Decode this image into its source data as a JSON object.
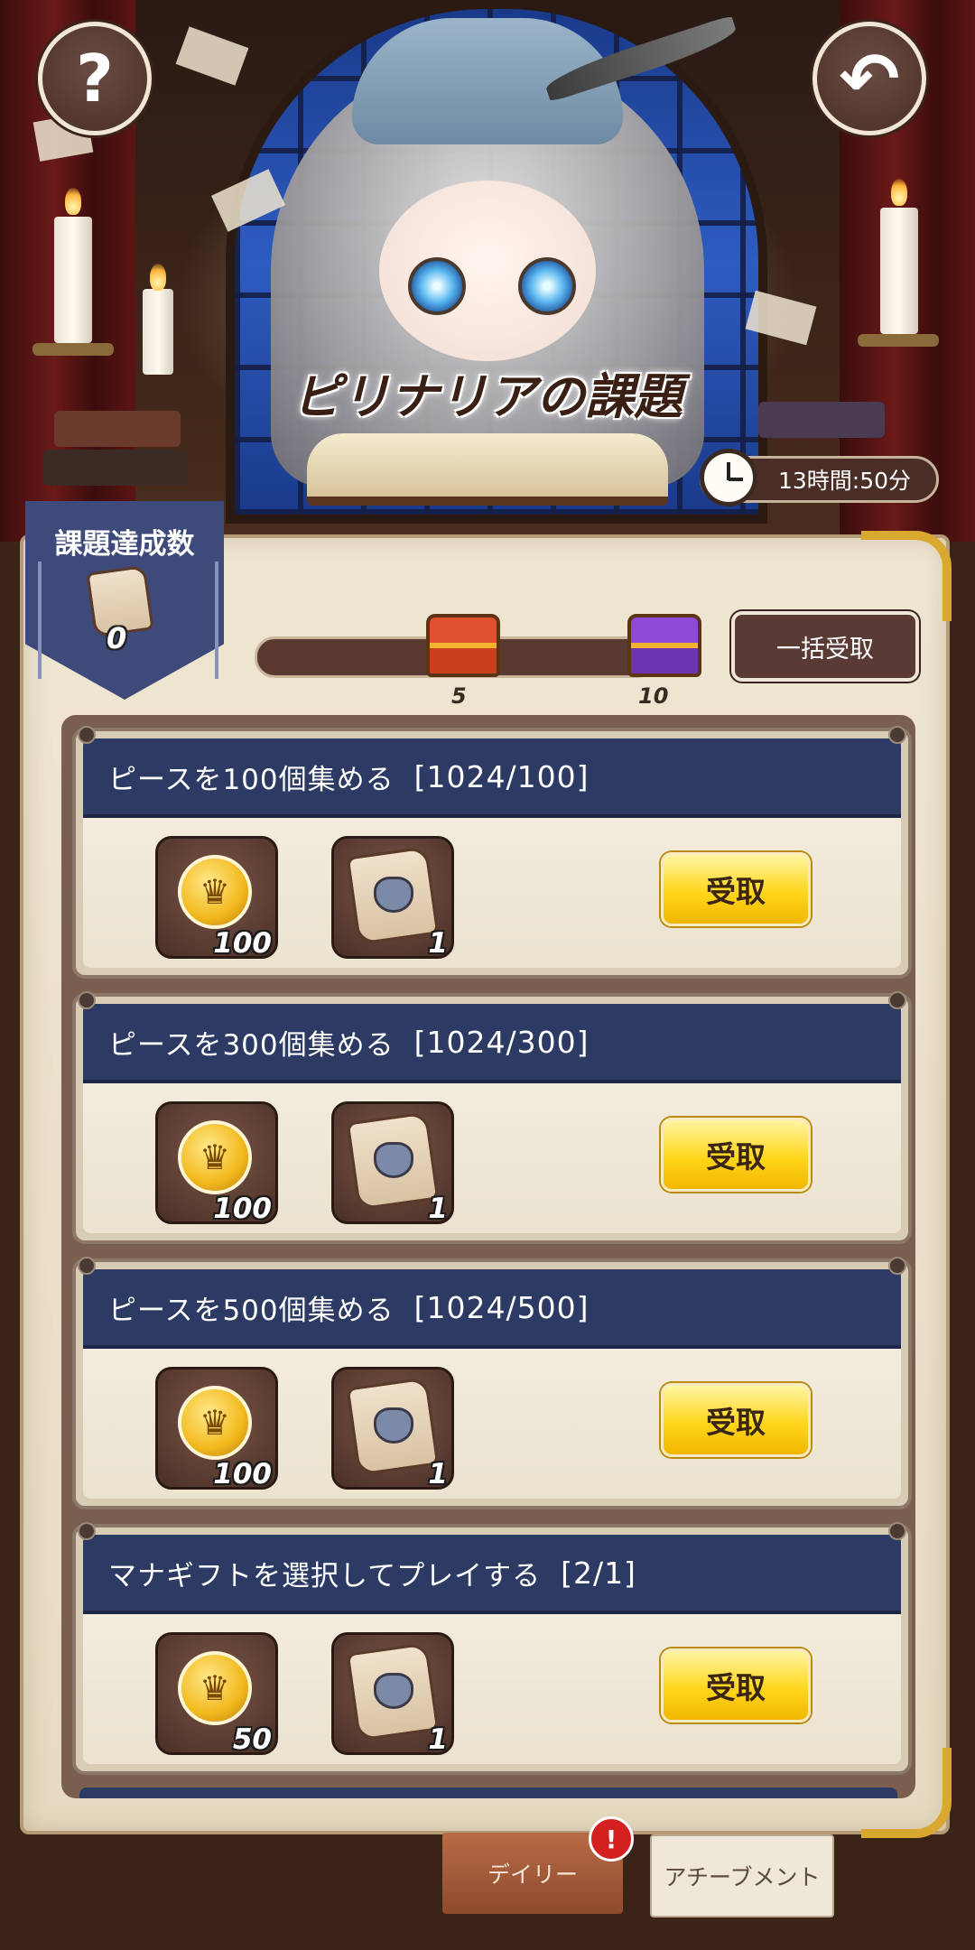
{
  "header": {
    "title": "ピリナリアの課題",
    "help_label": "?",
    "back_label": "↶",
    "timer": "13時間:50分"
  },
  "badge": {
    "label": "課題達成数",
    "count": "0"
  },
  "progress": {
    "value": 0,
    "max": 10,
    "milestones": [
      {
        "label": "5",
        "chest": "red-chest-icon"
      },
      {
        "label": "10",
        "chest": "purple-chest-icon"
      }
    ],
    "bulk_claim_label": "一括受取"
  },
  "tasks": [
    {
      "title": "ピースを100個集める",
      "progress": "[1024/100]",
      "rewards": [
        {
          "icon": "crown-coin-icon",
          "qty": "100"
        },
        {
          "icon": "owl-scroll-icon",
          "qty": "1"
        }
      ],
      "claim_label": "受取"
    },
    {
      "title": "ピースを300個集める",
      "progress": "[1024/300]",
      "rewards": [
        {
          "icon": "crown-coin-icon",
          "qty": "100"
        },
        {
          "icon": "owl-scroll-icon",
          "qty": "1"
        }
      ],
      "claim_label": "受取"
    },
    {
      "title": "ピースを500個集める",
      "progress": "[1024/500]",
      "rewards": [
        {
          "icon": "crown-coin-icon",
          "qty": "100"
        },
        {
          "icon": "owl-scroll-icon",
          "qty": "1"
        }
      ],
      "claim_label": "受取"
    },
    {
      "title": "マナギフトを選択してプレイする",
      "progress": "[2/1]",
      "rewards": [
        {
          "icon": "crown-coin-icon",
          "qty": "50"
        },
        {
          "icon": "owl-scroll-icon",
          "qty": "1"
        }
      ],
      "claim_label": "受取"
    }
  ],
  "tabs": {
    "daily": "デイリー",
    "achievement": "アチーブメント",
    "alert": "!"
  },
  "colors": {
    "header_bar": "#2d3a64",
    "claim_button": "#ffd61b",
    "badge": "#3e4a7a"
  }
}
